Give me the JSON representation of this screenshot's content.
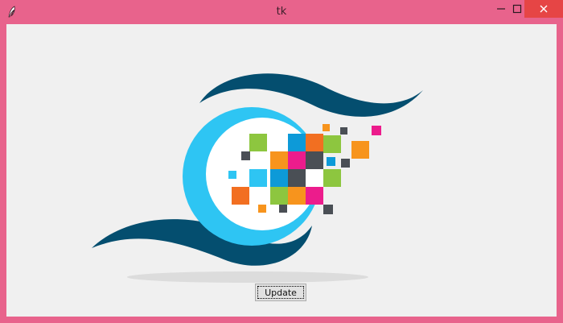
{
  "window": {
    "title": "tk",
    "app_icon": "feather-icon",
    "controls": {
      "minimize": "minimize-icon",
      "maximize": "maximize-icon",
      "close": "close-icon"
    },
    "frame_color": "#e8638c",
    "close_color": "#e64545"
  },
  "canvas": {
    "image": "eye-pixel-logo",
    "colors": {
      "dark_teal": "#044e6f",
      "sky_blue": "#2ec5f3",
      "green": "#8dc63f",
      "orange": "#f7941d",
      "deep_orange": "#f26f21",
      "magenta": "#ec1c8c",
      "blue": "#0d9ad8",
      "charcoal": "#4a4f55"
    }
  },
  "update_button": {
    "label": "Update"
  }
}
